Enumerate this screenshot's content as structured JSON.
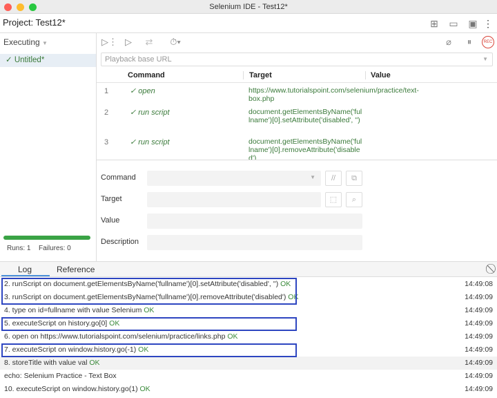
{
  "window": {
    "title": "Selenium IDE - Test12*"
  },
  "project": {
    "title": "Project:  Test12*",
    "icons": [
      "new-suite-icon",
      "open-folder-icon",
      "save-icon",
      "more-icon"
    ]
  },
  "sidebar": {
    "mode": "Executing",
    "suite": "✓ Untitled*",
    "progress": 1.0,
    "runs": "Runs: 1",
    "failures": "Failures: 0"
  },
  "toolbar": {
    "icons": [
      "run-all-icon",
      "run-icon",
      "step-icon",
      "speed-icon",
      "disable-breakpoints-icon",
      "pause-icon",
      "record-icon"
    ],
    "rec": "REC"
  },
  "url": {
    "placeholder": "Playback base URL"
  },
  "table": {
    "headers": [
      "Command",
      "Target",
      "Value"
    ],
    "rows": [
      {
        "n": "1",
        "cmd": "✓ open",
        "target": "https://www.tutorialspoint.com/selenium/practice/text-box.php",
        "value": ""
      },
      {
        "n": "2",
        "cmd": "✓ run script",
        "target": "document.getElementsByName('fullname')[0].setAttribute('disabled', '')",
        "value": ""
      },
      {
        "n": "3",
        "cmd": "✓ run script",
        "target": "document.getElementsByName('fullname')[0].removeAttribute('disabled')",
        "value": ""
      }
    ]
  },
  "form": {
    "command": "Command",
    "target": "Target",
    "value": "Value",
    "description": "Description",
    "comment_btn": "//"
  },
  "bottom": {
    "tabs": [
      "Log",
      "Reference"
    ],
    "log": [
      {
        "text": "2.  runScript on document.getElementsByName('fullname')[0].setAttribute('disabled', '')",
        "status": "OK",
        "time": "14:49:08"
      },
      {
        "text": "3.  runScript on document.getElementsByName('fullname')[0].removeAttribute('disabled')",
        "status": "OK",
        "time": "14:49:09"
      },
      {
        "text": "4.  type on id=fullname with value Selenium",
        "status": "OK",
        "time": "14:49:09"
      },
      {
        "text": "5.  executeScript on history.go[0]",
        "status": "OK",
        "time": "14:49:09"
      },
      {
        "text": "6.  open on https://www.tutorialspoint.com/selenium/practice/links.php",
        "status": "OK",
        "time": "14:49:09"
      },
      {
        "text": "7.  executeScript on window.history.go(-1)",
        "status": "OK",
        "time": "14:49:09"
      },
      {
        "text": "8.  storeTitle with value val",
        "status": "OK",
        "time": "14:49:09"
      },
      {
        "text": "echo: Selenium Practice - Text Box",
        "status": "",
        "time": "14:49:09"
      },
      {
        "text": "10. executeScript on window.history.go(1)",
        "status": "OK",
        "time": "14:49:09"
      }
    ]
  },
  "colors": {
    "highlight_box": "#2d45c0",
    "ok": "#3a8a3a",
    "progress": "#3aa345",
    "record": "#d9453a"
  }
}
